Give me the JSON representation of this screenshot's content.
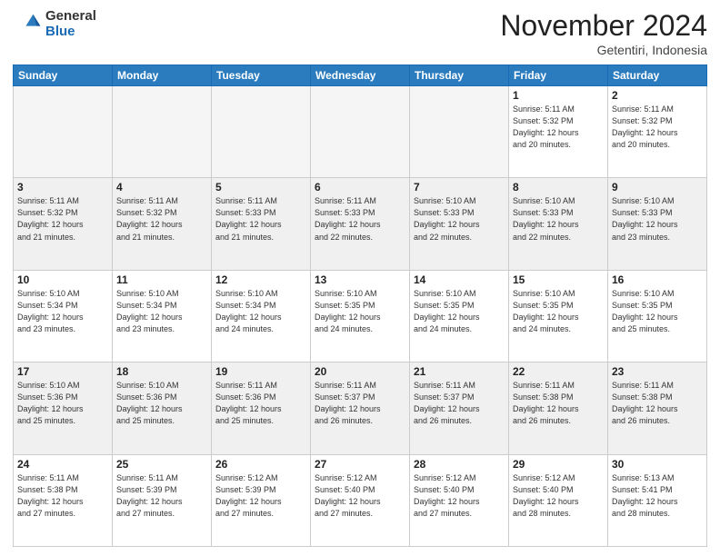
{
  "logo": {
    "general": "General",
    "blue": "Blue"
  },
  "header": {
    "month": "November 2024",
    "location": "Getentiri, Indonesia"
  },
  "weekdays": [
    "Sunday",
    "Monday",
    "Tuesday",
    "Wednesday",
    "Thursday",
    "Friday",
    "Saturday"
  ],
  "weeks": [
    [
      {
        "day": "",
        "detail": ""
      },
      {
        "day": "",
        "detail": ""
      },
      {
        "day": "",
        "detail": ""
      },
      {
        "day": "",
        "detail": ""
      },
      {
        "day": "",
        "detail": ""
      },
      {
        "day": "1",
        "detail": "Sunrise: 5:11 AM\nSunset: 5:32 PM\nDaylight: 12 hours\nand 20 minutes."
      },
      {
        "day": "2",
        "detail": "Sunrise: 5:11 AM\nSunset: 5:32 PM\nDaylight: 12 hours\nand 20 minutes."
      }
    ],
    [
      {
        "day": "3",
        "detail": "Sunrise: 5:11 AM\nSunset: 5:32 PM\nDaylight: 12 hours\nand 21 minutes."
      },
      {
        "day": "4",
        "detail": "Sunrise: 5:11 AM\nSunset: 5:32 PM\nDaylight: 12 hours\nand 21 minutes."
      },
      {
        "day": "5",
        "detail": "Sunrise: 5:11 AM\nSunset: 5:33 PM\nDaylight: 12 hours\nand 21 minutes."
      },
      {
        "day": "6",
        "detail": "Sunrise: 5:11 AM\nSunset: 5:33 PM\nDaylight: 12 hours\nand 22 minutes."
      },
      {
        "day": "7",
        "detail": "Sunrise: 5:10 AM\nSunset: 5:33 PM\nDaylight: 12 hours\nand 22 minutes."
      },
      {
        "day": "8",
        "detail": "Sunrise: 5:10 AM\nSunset: 5:33 PM\nDaylight: 12 hours\nand 22 minutes."
      },
      {
        "day": "9",
        "detail": "Sunrise: 5:10 AM\nSunset: 5:33 PM\nDaylight: 12 hours\nand 23 minutes."
      }
    ],
    [
      {
        "day": "10",
        "detail": "Sunrise: 5:10 AM\nSunset: 5:34 PM\nDaylight: 12 hours\nand 23 minutes."
      },
      {
        "day": "11",
        "detail": "Sunrise: 5:10 AM\nSunset: 5:34 PM\nDaylight: 12 hours\nand 23 minutes."
      },
      {
        "day": "12",
        "detail": "Sunrise: 5:10 AM\nSunset: 5:34 PM\nDaylight: 12 hours\nand 24 minutes."
      },
      {
        "day": "13",
        "detail": "Sunrise: 5:10 AM\nSunset: 5:35 PM\nDaylight: 12 hours\nand 24 minutes."
      },
      {
        "day": "14",
        "detail": "Sunrise: 5:10 AM\nSunset: 5:35 PM\nDaylight: 12 hours\nand 24 minutes."
      },
      {
        "day": "15",
        "detail": "Sunrise: 5:10 AM\nSunset: 5:35 PM\nDaylight: 12 hours\nand 24 minutes."
      },
      {
        "day": "16",
        "detail": "Sunrise: 5:10 AM\nSunset: 5:35 PM\nDaylight: 12 hours\nand 25 minutes."
      }
    ],
    [
      {
        "day": "17",
        "detail": "Sunrise: 5:10 AM\nSunset: 5:36 PM\nDaylight: 12 hours\nand 25 minutes."
      },
      {
        "day": "18",
        "detail": "Sunrise: 5:10 AM\nSunset: 5:36 PM\nDaylight: 12 hours\nand 25 minutes."
      },
      {
        "day": "19",
        "detail": "Sunrise: 5:11 AM\nSunset: 5:36 PM\nDaylight: 12 hours\nand 25 minutes."
      },
      {
        "day": "20",
        "detail": "Sunrise: 5:11 AM\nSunset: 5:37 PM\nDaylight: 12 hours\nand 26 minutes."
      },
      {
        "day": "21",
        "detail": "Sunrise: 5:11 AM\nSunset: 5:37 PM\nDaylight: 12 hours\nand 26 minutes."
      },
      {
        "day": "22",
        "detail": "Sunrise: 5:11 AM\nSunset: 5:38 PM\nDaylight: 12 hours\nand 26 minutes."
      },
      {
        "day": "23",
        "detail": "Sunrise: 5:11 AM\nSunset: 5:38 PM\nDaylight: 12 hours\nand 26 minutes."
      }
    ],
    [
      {
        "day": "24",
        "detail": "Sunrise: 5:11 AM\nSunset: 5:38 PM\nDaylight: 12 hours\nand 27 minutes."
      },
      {
        "day": "25",
        "detail": "Sunrise: 5:11 AM\nSunset: 5:39 PM\nDaylight: 12 hours\nand 27 minutes."
      },
      {
        "day": "26",
        "detail": "Sunrise: 5:12 AM\nSunset: 5:39 PM\nDaylight: 12 hours\nand 27 minutes."
      },
      {
        "day": "27",
        "detail": "Sunrise: 5:12 AM\nSunset: 5:40 PM\nDaylight: 12 hours\nand 27 minutes."
      },
      {
        "day": "28",
        "detail": "Sunrise: 5:12 AM\nSunset: 5:40 PM\nDaylight: 12 hours\nand 27 minutes."
      },
      {
        "day": "29",
        "detail": "Sunrise: 5:12 AM\nSunset: 5:40 PM\nDaylight: 12 hours\nand 28 minutes."
      },
      {
        "day": "30",
        "detail": "Sunrise: 5:13 AM\nSunset: 5:41 PM\nDaylight: 12 hours\nand 28 minutes."
      }
    ]
  ]
}
